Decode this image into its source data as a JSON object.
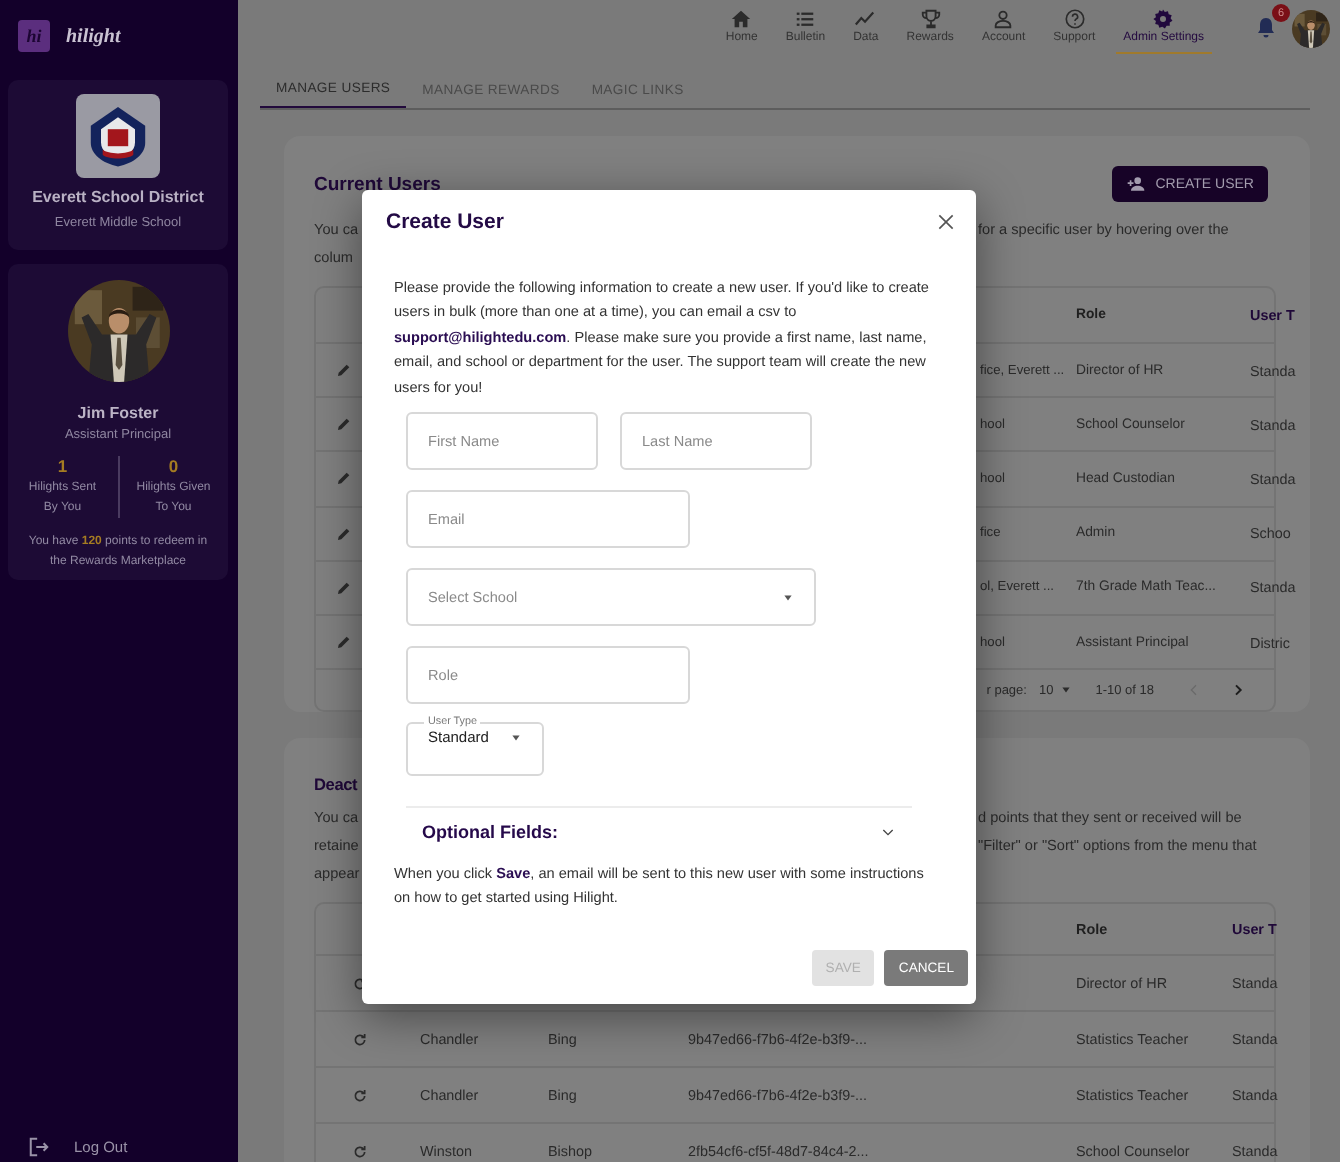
{
  "sidebar": {
    "logo_mark": "hi",
    "brand": "hilight",
    "school": {
      "district": "Everett School District",
      "school": "Everett Middle School"
    },
    "profile": {
      "name": "Jim Foster",
      "title": "Assistant Principal",
      "stats": [
        {
          "value": "1",
          "label": "Hilights Sent By You"
        },
        {
          "value": "0",
          "label": "Hilights Given To You"
        }
      ],
      "points_note": "You have **120** points to redeem in the Rewards Marketplace"
    },
    "logout": "Log Out"
  },
  "nav": {
    "items": [
      {
        "label": "Home",
        "selected": false
      },
      {
        "label": "Bulletin",
        "selected": false
      },
      {
        "label": "Data",
        "selected": false
      },
      {
        "label": "Rewards",
        "selected": false
      },
      {
        "label": "Account",
        "selected": false
      },
      {
        "label": "Support",
        "selected": false
      },
      {
        "label": "Admin Settings",
        "selected": true
      }
    ],
    "notification_count": "6"
  },
  "tabs": [
    {
      "label": "MANAGE USERS",
      "selected": true
    },
    {
      "label": "MANAGE REWARDS",
      "selected": false
    },
    {
      "label": "MAGIC LINKS",
      "selected": false
    }
  ],
  "current_users": {
    "title": "Current Users",
    "create_button": "CREATE USER",
    "intro": [
      {
        "left": "You ca",
        "right": "for a specific user by hovering over the"
      },
      {
        "left": "colum"
      }
    ],
    "columns": [
      "Role",
      "User T"
    ],
    "rows": [
      {
        "column_2": "fice, Everett ...",
        "role": "Director of HR",
        "user_type": "Standa"
      },
      {
        "column_2": "hool",
        "role": "School Counselor",
        "user_type": "Standa"
      },
      {
        "column_2": "hool",
        "role": "Head Custodian",
        "user_type": "Standa"
      },
      {
        "column_2": "fice",
        "role": "Admin",
        "user_type": "Schoo"
      },
      {
        "column_2": "ol, Everett ...",
        "role": "7th Grade Math Teac...",
        "user_type": "Standa"
      },
      {
        "column_2": "hool",
        "role": "Assistant Principal",
        "user_type": "Distric"
      }
    ],
    "pagination": {
      "rows_per_page_label": "r page:",
      "rows_per_page": "10",
      "range": "1-10 of 18",
      "previous_disabled": true,
      "next_disabled": false
    }
  },
  "deactivated_users": {
    "title": "Deact",
    "intro": [
      {
        "left": "You ca",
        "right": "d points that they sent or received will be"
      },
      {
        "left": "retaine",
        "right": "\"Filter\" or \"Sort\" options from the menu that"
      },
      {
        "left": "appear"
      }
    ],
    "columns": [
      "Role",
      "User T"
    ],
    "rows": [
      {
        "role": "Director of HR",
        "user_type": "Standa"
      },
      {
        "first_name": "Chandler",
        "last_name": "Bing",
        "id": "9b47ed66-f7b6-4f2e-b3f9-...",
        "role": "Statistics Teacher",
        "user_type": "Standa"
      },
      {
        "first_name": "Chandler",
        "last_name": "Bing",
        "id": "9b47ed66-f7b6-4f2e-b3f9-...",
        "role": "Statistics Teacher",
        "user_type": "Standa"
      },
      {
        "first_name": "Winston",
        "last_name": "Bishop",
        "id": "2fb54cf6-cf5f-48d7-84c4-2...",
        "role": "School Counselor",
        "user_type": "Standa"
      }
    ]
  },
  "dialog": {
    "title": "Create User",
    "intro": "Please provide the following information to create a new user. If you'd like to create users in bulk (more than one at a time), you can email a csv to **support@hilightedu.com**. Please make sure you provide a first name, last name, email, and school or department for the user. The support team will create the new users for you!",
    "fields": [
      {
        "kind": "text",
        "placeholder": "First Name"
      },
      {
        "kind": "text",
        "placeholder": "Last Name"
      },
      {
        "kind": "text",
        "placeholder": "Email"
      },
      {
        "kind": "select",
        "placeholder": "Select School"
      },
      {
        "kind": "text",
        "placeholder": "Role"
      },
      {
        "kind": "select",
        "label": "User Type",
        "value": "Standard"
      }
    ],
    "optional_fields": {
      "label": "Optional Fields:",
      "expanded": false
    },
    "note": "When you click **Save**, an email will be sent to this new user with some instructions on how to get started using Hilight.",
    "buttons": [
      {
        "label": "SAVE",
        "kind": "primary",
        "disabled": true
      },
      {
        "label": "CANCEL",
        "kind": "secondary",
        "disabled": false
      }
    ]
  }
}
